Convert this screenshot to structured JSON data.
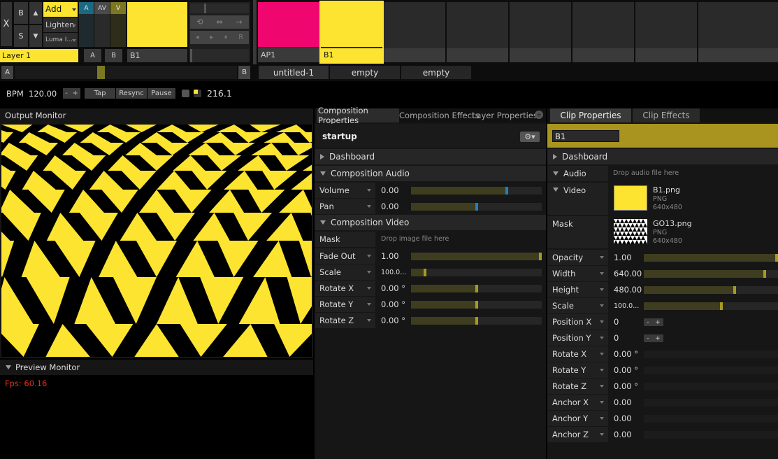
{
  "layer": {
    "x_label": "X",
    "b_label": "B",
    "s_label": "S",
    "up_label": "▲",
    "down_label": "▼",
    "blend_options": [
      "Add",
      "Lighten",
      "Luma I..."
    ],
    "av_buttons": [
      "A",
      "AV",
      "V"
    ],
    "name": "Layer 1",
    "clip_name": "B1",
    "ab_labels": [
      "A",
      "B"
    ],
    "clip_color": "#fce430"
  },
  "transport": {
    "icons": [
      "loop-icon",
      "bounce-icon",
      "forward-icon",
      "back-icon",
      "play-icon",
      "pause-icon",
      "random-icon"
    ],
    "glyphs": [
      "⟲",
      "⇔",
      "→",
      "◂",
      "▸",
      "⏸",
      "R"
    ]
  },
  "clips": [
    {
      "name": "AP1",
      "color": "#f0066f",
      "selected": false
    },
    {
      "name": "B1",
      "color": "#fce430",
      "selected": true
    },
    {
      "name": "",
      "color": "",
      "selected": false
    },
    {
      "name": "",
      "color": "",
      "selected": false
    },
    {
      "name": "",
      "color": "",
      "selected": false
    },
    {
      "name": "",
      "color": "",
      "selected": false
    },
    {
      "name": "",
      "color": "",
      "selected": false
    }
  ],
  "crossfader": {
    "a_label": "A",
    "b_label": "B",
    "position": 0.37
  },
  "deck_tabs": [
    "untitled-1",
    "empty",
    "empty"
  ],
  "bpm": {
    "label": "BPM",
    "value": "120.00",
    "minus": "-",
    "plus": "+",
    "tap": "Tap",
    "resync": "Resync",
    "pause": "Pause",
    "beat_value": "216.1"
  },
  "output_monitor": {
    "title": "Output Monitor"
  },
  "preview_monitor": {
    "title": "Preview Monitor",
    "fps": "Fps: 60.16"
  },
  "comp_panel": {
    "tabs": [
      "Composition Properties",
      "Composition Effects",
      "Layer Properties"
    ],
    "name": "startup",
    "dashboard": "Dashboard",
    "audio_section": "Composition Audio",
    "audio_rows": [
      {
        "label": "Volume",
        "value": "0.00",
        "level": 0.74
      },
      {
        "label": "Pan",
        "value": "0.00",
        "level": 0.5
      }
    ],
    "video_section": "Composition Video",
    "mask_label": "Mask",
    "mask_drop": "Drop image file here",
    "video_rows": [
      {
        "label": "Fade Out",
        "value": "1.00",
        "level": 1.0
      },
      {
        "label": "Scale",
        "value": "100.0...",
        "level": 0.1
      },
      {
        "label": "Rotate X",
        "value": "0.00 °",
        "level": 0.5
      },
      {
        "label": "Rotate Y",
        "value": "0.00 °",
        "level": 0.5
      },
      {
        "label": "Rotate Z",
        "value": "0.00 °",
        "level": 0.5
      }
    ]
  },
  "clip_panel": {
    "tabs": [
      "Clip Properties",
      "Clip Effects"
    ],
    "name_value": "B1",
    "dashboard": "Dashboard",
    "audio_label": "Audio",
    "audio_drop": "Drop audio file here",
    "video_label": "Video",
    "video_file": "B1.png",
    "video_type": "PNG",
    "video_size": "640x480",
    "mask_label": "Mask",
    "mask_file": "GO13.png",
    "mask_type": "PNG",
    "mask_size": "640x480",
    "rows": [
      {
        "label": "Opacity",
        "value": "1.00",
        "level": 1.0,
        "kind": "slider"
      },
      {
        "label": "Width",
        "value": "640.00",
        "level": 0.91,
        "kind": "slider"
      },
      {
        "label": "Height",
        "value": "480.00",
        "level": 0.68,
        "kind": "slider"
      },
      {
        "label": "Scale",
        "value": "100.0...",
        "level": 0.58,
        "kind": "slider"
      },
      {
        "label": "Position X",
        "value": "0",
        "kind": "stepper"
      },
      {
        "label": "Position Y",
        "value": "0",
        "kind": "stepper"
      },
      {
        "label": "Rotate X",
        "value": "0.00 °",
        "kind": "plain"
      },
      {
        "label": "Rotate Y",
        "value": "0.00 °",
        "kind": "plain"
      },
      {
        "label": "Rotate Z",
        "value": "0.00 °",
        "kind": "plain"
      },
      {
        "label": "Anchor X",
        "value": "0.00",
        "kind": "plain"
      },
      {
        "label": "Anchor Y",
        "value": "0.00",
        "kind": "plain"
      },
      {
        "label": "Anchor Z",
        "value": "0.00",
        "kind": "plain"
      }
    ],
    "stepper_minus": "-",
    "stepper_plus": "+"
  },
  "colors": {
    "accent_yellow": "#fce430",
    "slider_olive": "#4a4a22",
    "handle_yellow": "#a89a20",
    "handle_blue": "#1f7fbf",
    "fps_red": "#e0301e",
    "av_blue": "#1b6a82",
    "av_gray": "#4a4a4a",
    "av_olive": "#7b7722"
  }
}
